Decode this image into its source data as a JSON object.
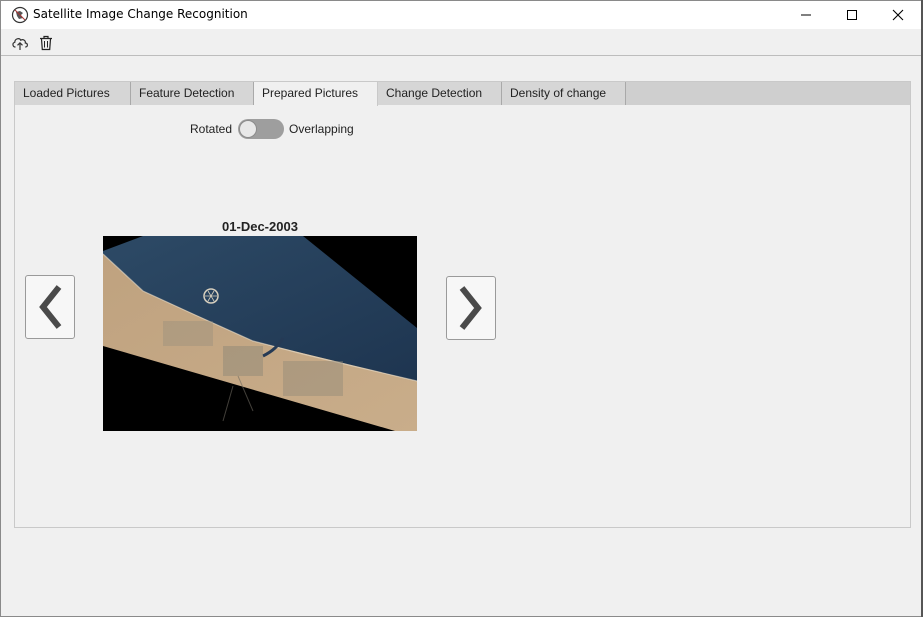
{
  "window": {
    "title": "Satellite Image Change Recognition"
  },
  "toolbar": {
    "upload_icon": "cloud-upload-icon",
    "delete_icon": "trash-icon"
  },
  "tabs": [
    {
      "label": "Loaded Pictures"
    },
    {
      "label": "Feature Detection"
    },
    {
      "label": "Prepared Pictures",
      "active": true
    },
    {
      "label": "Change Detection"
    },
    {
      "label": "Density of change"
    }
  ],
  "toggle": {
    "left_label": "Rotated",
    "right_label": "Overlapping",
    "state": "Rotated"
  },
  "image": {
    "date": "01-Dec-2003"
  },
  "nav": {
    "prev_icon": "chevron-left-icon",
    "next_icon": "chevron-right-icon"
  },
  "colors": {
    "tab_active": "#f0f0f0",
    "tab_inactive": "#d6d6d6",
    "toggle_track": "#9e9e9e",
    "chevron": "#4a4a4a"
  }
}
